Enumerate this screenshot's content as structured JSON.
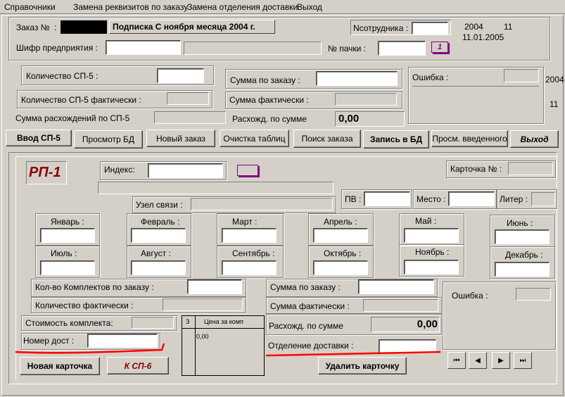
{
  "menu": [
    "Справочники",
    "Замена реквизитов по заказу",
    "Замена отделения доставки",
    "Выход"
  ],
  "header": {
    "order_label": "Заказ №",
    "subscription_title": "Подписка  С ноября месяца  2004 г.",
    "employee_label": "Nсотрудника :",
    "year": "2004",
    "month_num": "11",
    "date": "11.01.2005",
    "cipher_label": "Шифр предприятия :",
    "batch_label": "№ пачки :",
    "batch_btn": "1",
    "edge_year": "2004",
    "edge_month": "11"
  },
  "sp5": {
    "count_label": "Количество СП-5 :",
    "count_actual_label": "Количество СП-5 фактически :",
    "diff_label": "Сумма расхождений по СП-5",
    "sum_order_label": "Сумма по заказу :",
    "sum_actual_label": "Сумма фактически :",
    "sum_diff_label": "Расхожд. по сумме",
    "sum_diff_value": "0,00",
    "error_label": "Ошибка :"
  },
  "toolbar": [
    "Ввод СП-5",
    "Просмотр БД",
    "Новый заказ",
    "Очистка таблиц",
    "Поиск заказа",
    "Запись в БД",
    "Просм. введенного",
    "Выход"
  ],
  "card": {
    "title": "РП-1",
    "index_label": "Индекс:",
    "card_no_label": "Карточка № :",
    "node_label": "Узел связи :",
    "pv_label": "ПВ :",
    "place_label": "Место :",
    "liter_label": "Литер :",
    "months": [
      "Январь :",
      "Февраль :",
      "Март :",
      "Апрель :",
      "Май :",
      "Июнь :",
      "Июль :",
      "Август :",
      "Сентябрь :",
      "Октябрь :",
      "Ноябрь :",
      "Декабрь :"
    ],
    "kits_order_label": "Кол-во Комплектов по заказу :",
    "kits_actual_label": "Количество фактически :",
    "kit_cost_label": "Стоимость комплекта:",
    "sum_order_label": "Сумма по заказу :",
    "sum_actual_label": "Сумма фактически :",
    "sum_diff_label": "Расхожд. по сумме",
    "sum_diff_value": "0,00",
    "error_label": "Ошибка :",
    "grid_col1": "З",
    "grid_col2": "Цена за комп",
    "grid_value": "0,00",
    "delivery_no_label": "Номер дост :",
    "delivery_dept_label": "Отделение доставки :",
    "new_card_btn": "Новая карточка",
    "to_sp6_btn": "К СП-6",
    "delete_card_btn": "Удалить карточку",
    "nav": [
      "⏮",
      "◀",
      "▶",
      "⏭"
    ]
  },
  "colors": {
    "title_red": "#8b0000",
    "annotation_red": "#ff0000",
    "purple": "#800080"
  }
}
